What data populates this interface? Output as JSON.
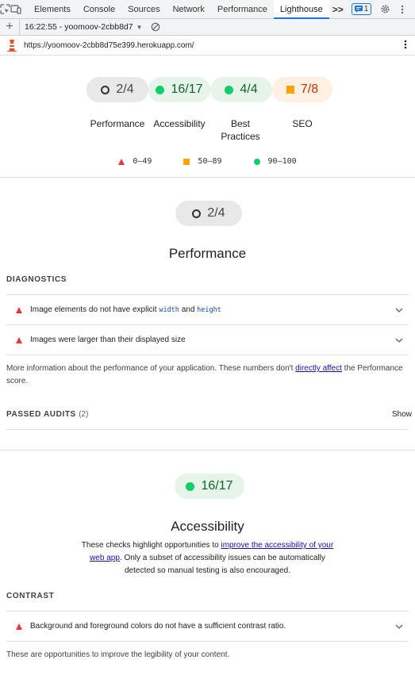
{
  "devtools": {
    "tabs": [
      "Elements",
      "Console",
      "Sources",
      "Network",
      "Performance",
      "Lighthouse"
    ],
    "active_tab": "Lighthouse",
    "more_label": ">>",
    "issues_count": "1"
  },
  "toolbar": {
    "report_label": "16:22:55 - yoomoov-2cbb8d7"
  },
  "url": "https://yoomoov-2cbb8d75e399.herokuapp.com/",
  "scores": [
    {
      "value": "2/4",
      "category": "Performance",
      "status": "na"
    },
    {
      "value": "16/17",
      "category": "Accessibility",
      "status": "pass"
    },
    {
      "value": "4/4",
      "category": "Best Practices",
      "status": "pass"
    },
    {
      "value": "7/8",
      "category": "SEO",
      "status": "average"
    }
  ],
  "best_practices_lines": [
    "Best",
    "Practices"
  ],
  "legend": [
    {
      "range": "0–49",
      "shape": "triangle",
      "color": "#e53935"
    },
    {
      "range": "50–89",
      "shape": "square",
      "color": "#ffa400"
    },
    {
      "range": "90–100",
      "shape": "circle",
      "color": "#0cce6b"
    }
  ],
  "performance": {
    "score": "2/4",
    "title": "Performance",
    "diagnostics_title": "DIAGNOSTICS",
    "audits": [
      {
        "before": "Image elements do not have explicit ",
        "code1": "width",
        "mid": " and ",
        "code2": "height"
      },
      {
        "text": "Images were larger than their displayed size"
      }
    ],
    "info_before": "More information about the performance of your application. These numbers don't ",
    "info_link": "directly affect",
    "info_after": " the Performance score.",
    "passed_title": "PASSED AUDITS",
    "passed_count": "(2)",
    "show_label": "Show"
  },
  "accessibility": {
    "score": "16/17",
    "title": "Accessibility",
    "desc_before": "These checks highlight opportunities to ",
    "desc_link": "improve the accessibility of your web app",
    "desc_after": ". Only a subset of accessibility issues can be automatically detected so manual testing is also encouraged.",
    "contrast_title": "CONTRAST",
    "contrast_audit": "Background and foreground colors do not have a sufficient contrast ratio.",
    "contrast_info": "These are opportunities to improve the legibility of your content."
  },
  "colors": {
    "pass": "#0cce6b",
    "average": "#ffa400",
    "fail": "#e53935",
    "accent": "#1a73e8"
  }
}
